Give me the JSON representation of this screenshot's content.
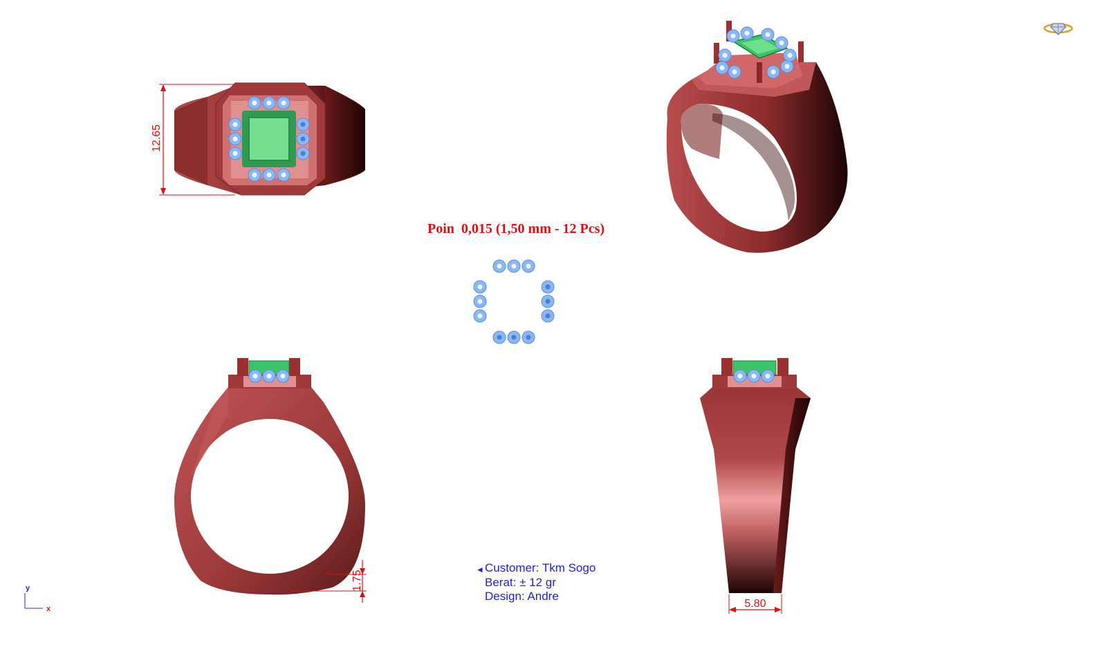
{
  "title": "Poin  0,015 (1,50 mm - 12 Pcs)",
  "dimensions": {
    "top_height": "12.65",
    "shank_thickness": "1.75",
    "shank_width": "5.80"
  },
  "info": {
    "customer": "Customer: Tkm Sogo",
    "weight": "Berat: ± 12 gr",
    "designer": "Design: Andre"
  },
  "axes": {
    "x": "x",
    "y": "y"
  },
  "colors": {
    "metal": "#9e3b3b",
    "metal_light": "#d47878",
    "metal_dark": "#4a1010",
    "emerald": "#3cc46a",
    "emerald_light": "#73e08f",
    "stone": "#7eb0f0",
    "stone_dark": "#4a7fd0",
    "dimension": "#e01010",
    "annotation": "#1e1ee0"
  }
}
